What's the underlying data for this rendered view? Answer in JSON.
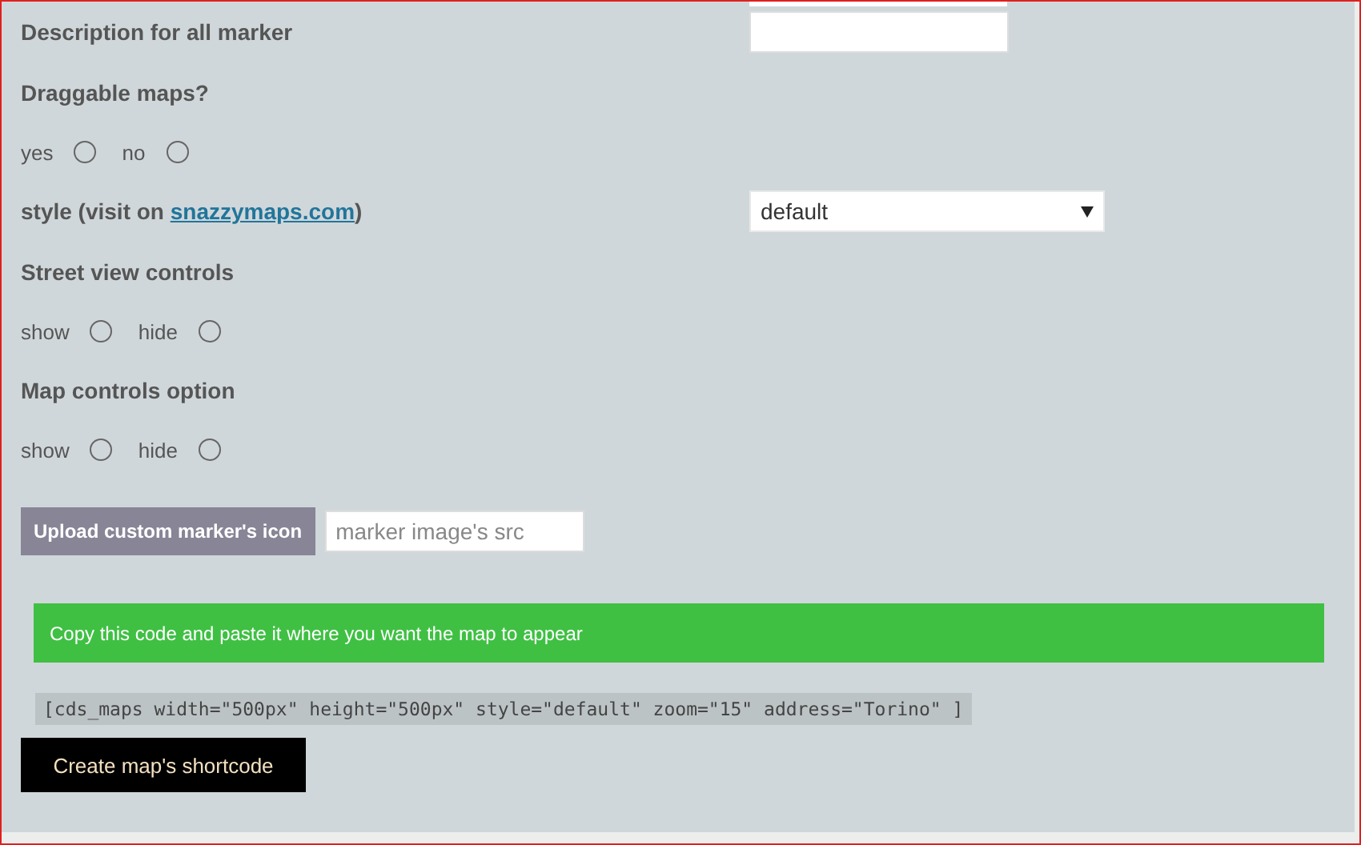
{
  "fields": [
    {
      "kind": "text",
      "label": "Description for all marker"
    },
    {
      "kind": "radio",
      "label": "Draggable maps?",
      "options": [
        {
          "label": "yes",
          "selected": false
        },
        {
          "label": "no",
          "selected": false
        }
      ]
    },
    {
      "kind": "select",
      "label_parts": [
        "style (visit on ",
        "snazzymaps.com",
        ")"
      ],
      "value": "default"
    },
    {
      "kind": "radio",
      "label": "Street view controls",
      "options": [
        {
          "label": "show",
          "selected": false
        },
        {
          "label": "hide",
          "selected": false
        }
      ]
    },
    {
      "kind": "radio",
      "label": "Map controls option",
      "options": [
        {
          "label": "show",
          "selected": false
        },
        {
          "label": "hide",
          "selected": false
        }
      ]
    }
  ],
  "upload": {
    "button": "Upload custom marker's icon",
    "placeholder": "marker image's src"
  },
  "notice": "Copy this code and paste it where you want the map to appear",
  "shortcode": "[cds_maps width=\"500px\" height=\"500px\" style=\"default\" zoom=\"15\" address=\"Torino\" ]",
  "submit": "Create map's shortcode"
}
